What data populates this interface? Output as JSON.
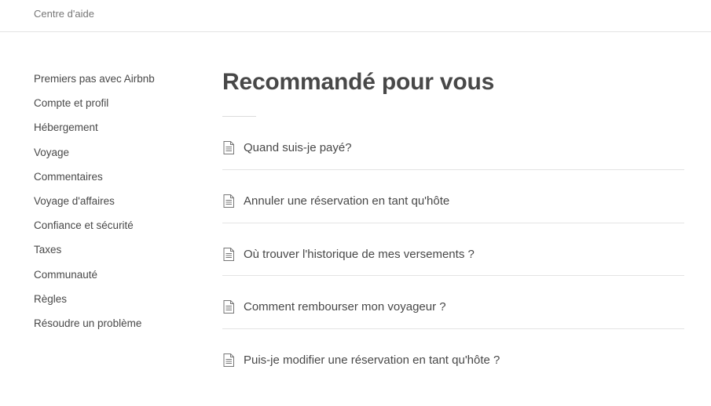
{
  "header": {
    "breadcrumb": "Centre d'aide"
  },
  "sidebar": {
    "items": [
      {
        "label": "Premiers pas avec Airbnb"
      },
      {
        "label": "Compte et profil"
      },
      {
        "label": "Hébergement"
      },
      {
        "label": "Voyage"
      },
      {
        "label": "Commentaires"
      },
      {
        "label": "Voyage d'affaires"
      },
      {
        "label": "Confiance et sécurité"
      },
      {
        "label": "Taxes"
      },
      {
        "label": "Communauté"
      },
      {
        "label": "Règles"
      },
      {
        "label": "Résoudre un problème"
      }
    ]
  },
  "main": {
    "title": "Recommandé pour vous",
    "articles": [
      {
        "title": "Quand suis-je payé?",
        "icon": "document-icon"
      },
      {
        "title": "Annuler une réservation en tant qu'hôte",
        "icon": "document-icon"
      },
      {
        "title": "Où trouver l'historique de mes versements ?",
        "icon": "document-icon"
      },
      {
        "title": "Comment rembourser mon voyageur ?",
        "icon": "document-icon"
      },
      {
        "title": "Puis-je modifier une réservation en tant qu'hôte ?",
        "icon": "document-icon"
      }
    ]
  },
  "colors": {
    "text": "#484848",
    "muted": "#767676",
    "divider": "#e4e4e4"
  }
}
